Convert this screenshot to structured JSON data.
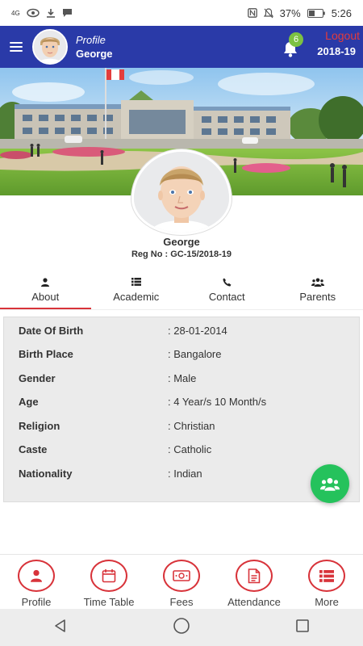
{
  "status_bar": {
    "network": "4G",
    "battery": "37%",
    "time": "5:26"
  },
  "header": {
    "label": "Profile",
    "name": "George",
    "notification_count": "6",
    "logout": "Logout",
    "year": "2018-19"
  },
  "profile": {
    "name": "George",
    "reg_no": "Reg No : GC-15/2018-19"
  },
  "tabs": [
    {
      "label": "About",
      "icon": "user-icon",
      "active": true
    },
    {
      "label": "Academic",
      "icon": "list-icon",
      "active": false
    },
    {
      "label": "Contact",
      "icon": "phone-icon",
      "active": false
    },
    {
      "label": "Parents",
      "icon": "users-icon",
      "active": false
    }
  ],
  "about": [
    {
      "key": "Date Of Birth",
      "value": ": 28-01-2014"
    },
    {
      "key": "Birth Place",
      "value": ": Bangalore"
    },
    {
      "key": "Gender",
      "value": ": Male"
    },
    {
      "key": "Age",
      "value": ": 4 Year/s 10 Month/s"
    },
    {
      "key": "Religion",
      "value": ": Christian"
    },
    {
      "key": "Caste",
      "value": ": Catholic"
    },
    {
      "key": "Nationality",
      "value": ": Indian"
    }
  ],
  "bottom_nav": [
    {
      "label": "Profile",
      "icon": "user-icon"
    },
    {
      "label": "Time Table",
      "icon": "calendar-icon"
    },
    {
      "label": "Fees",
      "icon": "money-icon"
    },
    {
      "label": "Attendance",
      "icon": "document-icon"
    },
    {
      "label": "More",
      "icon": "list-icon"
    }
  ],
  "colors": {
    "app_bar": "#2a3aa8",
    "accent": "#d8333a",
    "badge": "#7cc142",
    "fab": "#25c25c"
  }
}
